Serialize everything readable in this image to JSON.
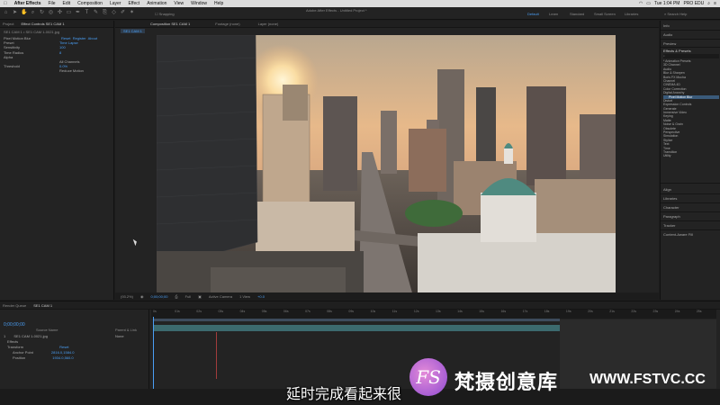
{
  "menubar": {
    "app": "After Effects",
    "items": [
      "File",
      "Edit",
      "Composition",
      "Layer",
      "Effect",
      "Animation",
      "View",
      "Window",
      "Help"
    ],
    "clock": "Tue 1:04 PM",
    "user": "PRO EDU"
  },
  "window": {
    "title": "Adobe After Effects - Untitled Project *"
  },
  "toolbar": {
    "snapping_label": "Snapping",
    "workspaces": [
      "Default",
      "Learn",
      "Standard",
      "Small Screen",
      "Libraries"
    ],
    "active_workspace": "Default",
    "search_placeholder": "Search Help"
  },
  "left_panel": {
    "tabs": [
      "Project",
      "Effect Controls SE1 CAM 1"
    ],
    "header": "SE1 CAM 1 • SE1 CAM 1-0021.jpg",
    "effects": [
      {
        "label": "Pixel Motion Blur",
        "value": ""
      },
      {
        "label": "Preset",
        "value": "Time Lapse"
      },
      {
        "label": "Sensitivity",
        "value": "100"
      },
      {
        "label": "Time Radius",
        "value": "8"
      },
      {
        "label": "Alpha",
        "value": ""
      },
      {
        "label": "",
        "value": "All Channels"
      },
      {
        "label": "Threshold",
        "value": "0.0%"
      },
      {
        "label": "",
        "value": "Reduce Motion"
      }
    ],
    "reset_labels": [
      "Reset",
      "Register",
      "About"
    ]
  },
  "comp_panel": {
    "tabs": [
      "Composition SE1 CAM 1",
      "Footage (none)",
      "Layer (none)"
    ],
    "active_tab": "Composition SE1 CAM 1",
    "sub_tab": "SE1 CAM 1",
    "viewer": {
      "zoom": "(93.2%)",
      "timecode": "0;00;00;00",
      "resolution": "Full",
      "camera": "Active Camera",
      "views": "1 View",
      "exposure": "+0.0"
    }
  },
  "right_panel": {
    "sections": [
      "Info",
      "Audio",
      "Preview",
      "Effects & Presets"
    ],
    "search_placeholder": "",
    "effects_list": [
      "* Animation Presets",
      "3D Channel",
      "Audio",
      "Blur & Sharpen",
      "Boris FX Mocha",
      "Channel",
      "CINEMA 4D",
      "Color Correction",
      "Digital Anarchy",
      "Pixel Motion Blur",
      "Distort",
      "Expression Controls",
      "Generate",
      "Immersive Video",
      "Keying",
      "Matte",
      "Noise & Grain",
      "Obsolete",
      "Perspective",
      "Simulation",
      "Stylize",
      "Text",
      "Time",
      "Transition",
      "Utility"
    ],
    "selected_effect": "Pixel Motion Blur",
    "lower_sections": [
      "Align",
      "Libraries",
      "Character",
      "Paragraph",
      "Tracker",
      "Content-Aware Fill"
    ]
  },
  "timeline": {
    "tabs": [
      "Render Queue",
      "SE1 CAM 1"
    ],
    "timecode": "0;00;00;00",
    "column_header": "Source Name",
    "parent_header": "Parent & Link",
    "layers": [
      {
        "index": "1",
        "name": "SE1 CAM 1-0021.jpg",
        "parent": "None"
      }
    ],
    "properties": [
      {
        "label": "Effects",
        "value": ""
      },
      {
        "label": "Transform",
        "value": "Reset"
      },
      {
        "label": "Anchor Point",
        "value": "2816.0,1584.0"
      },
      {
        "label": "Position",
        "value": "1934.0,560.0"
      }
    ],
    "ruler_ticks": [
      "0s",
      "01s",
      "02s",
      "03s",
      "04s",
      "05s",
      "06s",
      "07s",
      "08s",
      "09s",
      "10s",
      "11s",
      "12s",
      "13s",
      "14s",
      "15s",
      "16s",
      "17s",
      "18s",
      "19s",
      "20s",
      "21s",
      "22s",
      "23s",
      "24s",
      "25s"
    ]
  },
  "overlay": {
    "subtitle": "延时完成看起来很",
    "logo_text": "FS",
    "brand_cn": "梵摄创意库",
    "brand_url": "WWW.FSTVC.CC"
  },
  "colors": {
    "accent": "#4a9ff5",
    "panel": "#232323",
    "track": "#3c6a6e"
  }
}
